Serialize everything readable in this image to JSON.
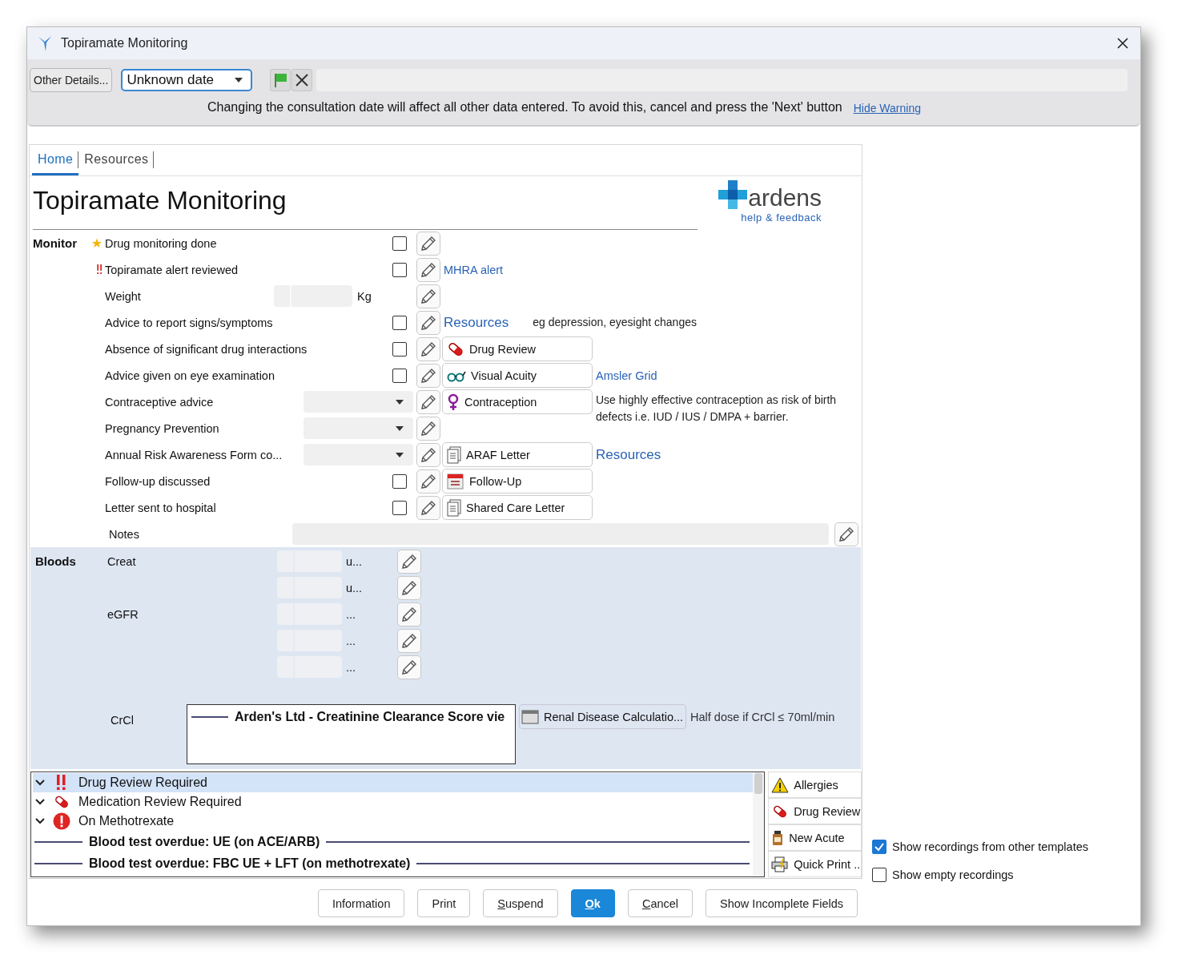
{
  "window": {
    "title": "Topiramate Monitoring"
  },
  "toolbar": {
    "other_details": "Other Details...",
    "date": "Unknown date",
    "warning": "Changing the consultation date will affect all other data entered. To avoid this, cancel and press the 'Next' button",
    "hide_warning": "Hide Warning"
  },
  "tabs": [
    {
      "label": "Home",
      "selected": true
    },
    {
      "label": "Resources",
      "selected": false
    }
  ],
  "heading": "Topiramate Monitoring",
  "logo": {
    "name": "ardens",
    "link": "help & feedback"
  },
  "monitor": {
    "title": "Monitor",
    "rows": [
      {
        "label": "Drug monitoring done",
        "marker": {
          "text": "★",
          "color": "#f4b400"
        },
        "kind": "checkbox",
        "checked": false
      },
      {
        "label": "Topiramate alert reviewed",
        "marker": {
          "text": "‼",
          "color": "#d01010"
        },
        "kind": "checkbox",
        "checked": false,
        "extras": [
          {
            "kind": "link",
            "text": "MHRA alert"
          }
        ]
      },
      {
        "label": "Weight",
        "kind": "number",
        "unit": "Kg"
      },
      {
        "label": "Advice to report signs/symptoms",
        "kind": "checkbox",
        "checked": false,
        "extras": [
          {
            "kind": "heading",
            "text": "Resources"
          },
          {
            "kind": "note",
            "text": "eg depression, eyesight changes"
          }
        ]
      },
      {
        "label": "Absence of significant drug interactions",
        "kind": "checkbox",
        "checked": false,
        "action": {
          "label": "Drug Review",
          "kind": "medication"
        }
      },
      {
        "label": "Advice given on eye examination",
        "kind": "checkbox",
        "checked": false,
        "action": {
          "label": "Visual Acuity",
          "kind": "vision"
        },
        "extras": [
          {
            "kind": "link",
            "text": "Amsler Grid"
          }
        ]
      },
      {
        "label": "Contraceptive advice",
        "kind": "dropdown",
        "action": {
          "label": "Contraception",
          "kind": "contraception"
        },
        "extras": [
          {
            "kind": "note",
            "text": "Use highly effective contraception as risk of birth defects i.e. IUD / IUS / DMPA + barrier."
          }
        ]
      },
      {
        "label": "Pregnancy Prevention",
        "kind": "dropdown"
      },
      {
        "label": "Annual Risk Awareness Form co...",
        "kind": "dropdown",
        "action": {
          "label": "ARAF Letter",
          "kind": "letter"
        },
        "extras": [
          {
            "kind": "heading",
            "text": "Resources"
          }
        ]
      },
      {
        "label": "Follow-up discussed",
        "kind": "checkbox",
        "checked": false,
        "action": {
          "label": "Follow-Up",
          "kind": "appointment"
        }
      },
      {
        "label": "Letter sent to hospital",
        "kind": "checkbox",
        "checked": false,
        "action": {
          "label": "Shared Care Letter",
          "kind": "letter"
        }
      }
    ],
    "notes_label": "Notes"
  },
  "bloods": {
    "title": "Bloods",
    "rows": [
      {
        "label": "Creat",
        "unit": "u..."
      },
      {
        "unit": "u..."
      },
      {
        "label": "eGFR",
        "unit": "..."
      },
      {
        "unit": "..."
      },
      {
        "unit": "..."
      }
    ],
    "crcl": {
      "label": "CrCl",
      "viewer_title": "Arden's Ltd - Creatinine Clearance Score vie",
      "button": "Renal Disease Calculatio...",
      "note": "Half dose if CrCl ≤ 70ml/min"
    }
  },
  "alerts": [
    {
      "kind": "critical",
      "text": "Drug Review Required",
      "selected": true
    },
    {
      "kind": "medication",
      "text": "Medication Review Required",
      "selected": false
    },
    {
      "kind": "urgent",
      "text": "On Methotrexate",
      "selected": false
    },
    {
      "kind": "banner",
      "text": "Blood test overdue: UE (on ACE/ARB)"
    },
    {
      "kind": "banner",
      "text": "Blood test overdue: FBC UE + LFT (on methotrexate)"
    }
  ],
  "side_buttons": [
    {
      "label": "Allergies",
      "kind": "allergy"
    },
    {
      "label": "Drug Review",
      "kind": "medication"
    },
    {
      "label": "New Acute",
      "kind": "acute"
    },
    {
      "label": "Quick Print ..",
      "kind": "print"
    }
  ],
  "options": [
    {
      "label": "Show recordings from other templates",
      "checked": true
    },
    {
      "label": "Show empty recordings",
      "checked": false
    }
  ],
  "footer": [
    {
      "label": "Information",
      "mnemonic": false,
      "primary": false
    },
    {
      "label": "Print",
      "mnemonic": false,
      "primary": false
    },
    {
      "label": "Suspend",
      "mnemonic": true,
      "primary": false
    },
    {
      "label": "Ok",
      "mnemonic": true,
      "primary": true
    },
    {
      "label": "Cancel",
      "mnemonic": true,
      "primary": false
    },
    {
      "label": "Show Incomplete Fields",
      "mnemonic": false,
      "primary": false
    }
  ]
}
